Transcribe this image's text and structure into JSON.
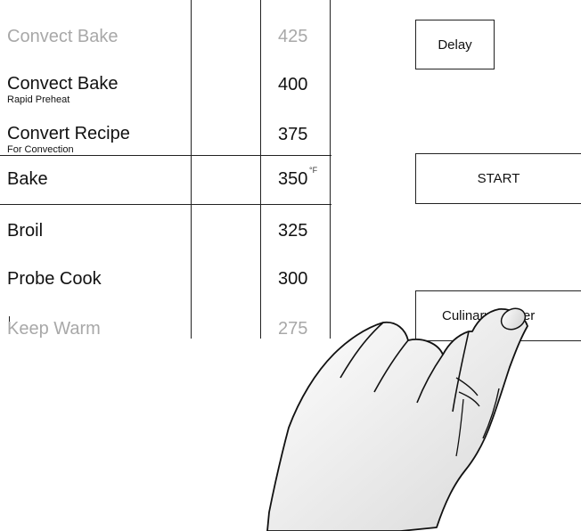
{
  "modes": [
    {
      "label": "Convect Bake",
      "sub": "",
      "faded": true
    },
    {
      "label": "Convect Bake",
      "sub": "Rapid Preheat",
      "faded": false
    },
    {
      "label": "Convert Recipe",
      "sub": "For Convection",
      "faded": false
    },
    {
      "label": "Bake",
      "sub": "",
      "faded": false,
      "selected": true
    },
    {
      "label": "Broil",
      "sub": "",
      "faded": false
    },
    {
      "label": "Probe Cook",
      "sub": "",
      "faded": false
    },
    {
      "label": "Keep Warm",
      "sub": "",
      "faded": true
    }
  ],
  "temperatures": [
    "425",
    "400",
    "375",
    "350",
    "325",
    "300",
    "275"
  ],
  "unit": "°F",
  "buttons": {
    "delay": "Delay",
    "start": "START",
    "culinary_center": "Culinary Center"
  },
  "colors": {
    "line": "#222222",
    "faded_text": "#a8a8a8",
    "text": "#111111"
  }
}
